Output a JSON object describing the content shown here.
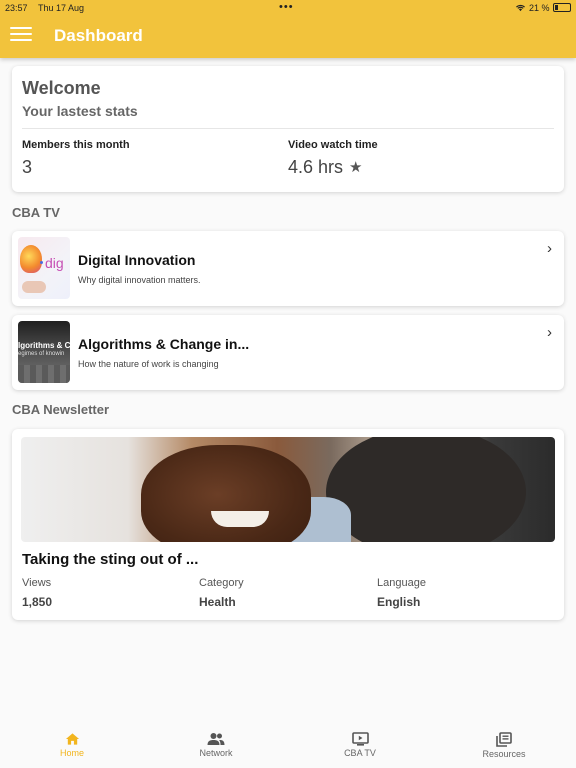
{
  "status_bar": {
    "time": "23:57",
    "date": "Thu 17 Aug",
    "battery": "21 %"
  },
  "header": {
    "title": "Dashboard"
  },
  "welcome": {
    "title": "Welcome",
    "subtitle": "Your lastest stats",
    "stats": [
      {
        "label": "Members this month",
        "value": "3"
      },
      {
        "label": "Video watch time",
        "value": "4.6 hrs"
      }
    ]
  },
  "cba_tv": {
    "section_title": "CBA TV",
    "videos": [
      {
        "title": "Digital Innovation",
        "description": "Why digital innovation matters.",
        "thumb_text": "dig"
      },
      {
        "title": "Algorithms & Change in...",
        "description": "How the nature of work is changing",
        "thumb_text": "lgorithms & Cha",
        "thumb_subtext": "egimes of knowin"
      }
    ]
  },
  "newsletter": {
    "section_title": "CBA Newsletter",
    "article": {
      "title": "Taking the sting out of ...",
      "meta": [
        {
          "label": "Views",
          "value": "1,850"
        },
        {
          "label": "Category",
          "value": "Health"
        },
        {
          "label": "Language",
          "value": "English"
        }
      ]
    }
  },
  "bottom_nav": {
    "accent": "#f2b51e",
    "items": [
      {
        "label": "Home",
        "icon": "home-icon",
        "active": true
      },
      {
        "label": "Network",
        "icon": "people-icon",
        "active": false
      },
      {
        "label": "CBA TV",
        "icon": "tv-icon",
        "active": false
      },
      {
        "label": "Resources",
        "icon": "library-icon",
        "active": false
      }
    ]
  },
  "colors": {
    "header": "#f2c33c",
    "background": "#fafafa"
  }
}
